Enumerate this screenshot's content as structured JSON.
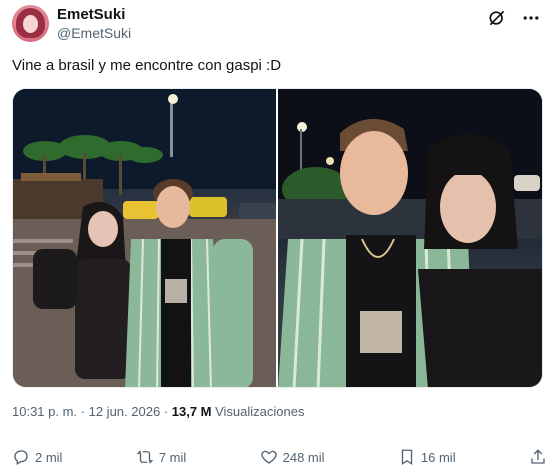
{
  "user": {
    "name": "EmetSuki",
    "handle": "@EmetSuki"
  },
  "header_icons": [
    "grok-icon",
    "more-icon"
  ],
  "tweet": {
    "text": "Vine a brasil y me encontre con gaspi :D"
  },
  "meta": {
    "time": "10:31 p. m.",
    "separator": " · ",
    "date": "12 jun. 2026",
    "separator2": " · ",
    "views_count": "13,7 M",
    "views_label": " Visualizaciones"
  },
  "actions": {
    "replies": "2 mil",
    "reposts": "7 mil",
    "likes": "248 mil",
    "bookmarks": "16 mil"
  },
  "icons": {
    "reply": "reply-icon",
    "repost": "repost-icon",
    "like": "heart-icon",
    "bookmark": "bookmark-icon",
    "share": "share-icon"
  },
  "colors": {
    "text": "#0f1419",
    "secondary": "#536471"
  }
}
